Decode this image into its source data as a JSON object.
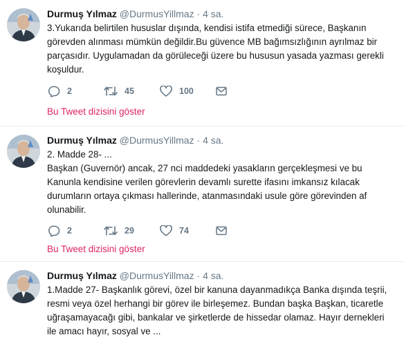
{
  "author": {
    "fullname": "Durmuş Yılmaz",
    "username": "@DurmusYillmaz",
    "separator": "·"
  },
  "colors": {
    "text": "#14171a",
    "muted": "#657786",
    "link": "#e0245e",
    "divider": "#e6ecf0"
  },
  "icons": [
    "reply-icon",
    "retweet-icon",
    "like-icon",
    "dm-icon"
  ],
  "tweets": [
    {
      "time": "4 sa.",
      "lines": [
        "3.Yukarıda belirtilen hususlar dışında, kendisi istifa etmediği sürece, Başkanın",
        "görevden alınması mümkün değildir.Bu güvence MB bağımsızlığının ayrılmaz bir",
        "parçasıdır. Uygulamadan da görüleceği üzere bu hususun yasada yazması gerekli",
        "koşuldur."
      ],
      "replies": "2",
      "retweets": "45",
      "likes": "100",
      "thread_link": "Bu Tweet dizisini göster"
    },
    {
      "time": "4 sa.",
      "lines": [
        "2. Madde 28- ...",
        "Başkan (Guvernör) ancak, 27 nci maddedeki yasakların gerçekleşmesi ve bu",
        "Kanunla kendisine verilen görevlerin devamlı surette ifasını imkansız kılacak",
        "durumların ortaya çıkması hallerinde, atanmasındaki usule göre görevinden af",
        "olunabilir."
      ],
      "replies": "2",
      "retweets": "29",
      "likes": "74",
      "thread_link": "Bu Tweet dizisini göster"
    },
    {
      "time": "4 sa.",
      "lines": [
        "1.Madde 27- Başkanlık  görevi, özel bir kanuna dayanmadıkça Banka dışında teşrii,",
        "resmi veya özel herhangi bir görev ile birleşemez. Bundan başka Başkan, ticaretle",
        "uğraşamayacağı gibi, bankalar ve şirketlerde de hissedar olamaz. Hayır dernekleri",
        "ile amacı hayır, sosyal ve ..."
      ]
    }
  ]
}
